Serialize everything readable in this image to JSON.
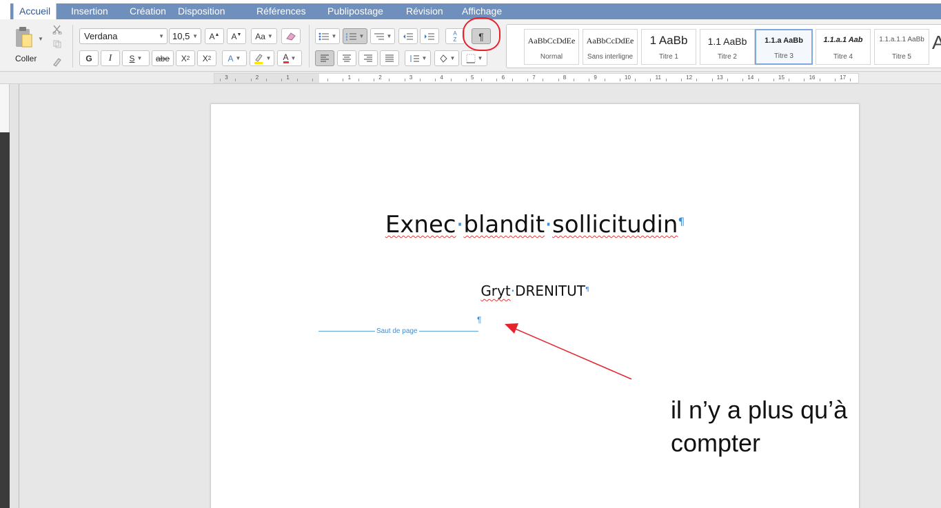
{
  "tabs": [
    {
      "label": "Accueil",
      "active": true
    },
    {
      "label": "Insertion"
    },
    {
      "label": "Création"
    },
    {
      "label": "Disposition"
    },
    {
      "label": "Références"
    },
    {
      "label": "Publipostage"
    },
    {
      "label": "Révision"
    },
    {
      "label": "Affichage"
    }
  ],
  "ribbon": {
    "paste_label": "Coller",
    "font_name": "Verdana",
    "font_size": "10,5",
    "bold": "G",
    "italic": "I",
    "underline": "S",
    "strike": "abe",
    "subscript": "X",
    "subscript_mark": "2",
    "superscript": "X",
    "superscript_mark": "2",
    "sort_mark": "A Z",
    "pilcrow": "¶"
  },
  "styles": [
    {
      "preview": "AaBbCcDdEe",
      "caption": "Normal"
    },
    {
      "preview": "AaBbCcDdEe",
      "caption": "Sans interligne"
    },
    {
      "preview": "1  AaBb",
      "caption": "Titre 1"
    },
    {
      "preview": "1.1  AaBb",
      "caption": "Titre 2"
    },
    {
      "preview": "1.1.a  AaBb",
      "caption": "Titre 3",
      "selected": true
    },
    {
      "preview": "1.1.a.1  Aab",
      "caption": "Titre 4"
    },
    {
      "preview": "1.1.a.1.1  AaBb",
      "caption": "Titre 5"
    }
  ],
  "ruler": {
    "left_numbers": [
      "3",
      "2",
      "1"
    ],
    "right_numbers": [
      "1",
      "2",
      "3",
      "4",
      "5",
      "6",
      "7",
      "8",
      "9",
      "10",
      "11",
      "12",
      "13",
      "14",
      "15",
      "16",
      "17"
    ]
  },
  "document": {
    "title_words": [
      "Exnec",
      "blandit",
      "sollicitudin"
    ],
    "subtitle_words": [
      "Gryt",
      "DRENITUT"
    ],
    "space_mark": "·",
    "paragraph_mark": "¶",
    "page_break_label": "Saut de page"
  },
  "annotation": {
    "line1": "il n’y a plus qu’à",
    "line2": "compter"
  },
  "colors": {
    "tab_bar": "#6f8fbd",
    "formatting_marks": "#3b8ed8",
    "annotation_red": "#e8222b"
  }
}
